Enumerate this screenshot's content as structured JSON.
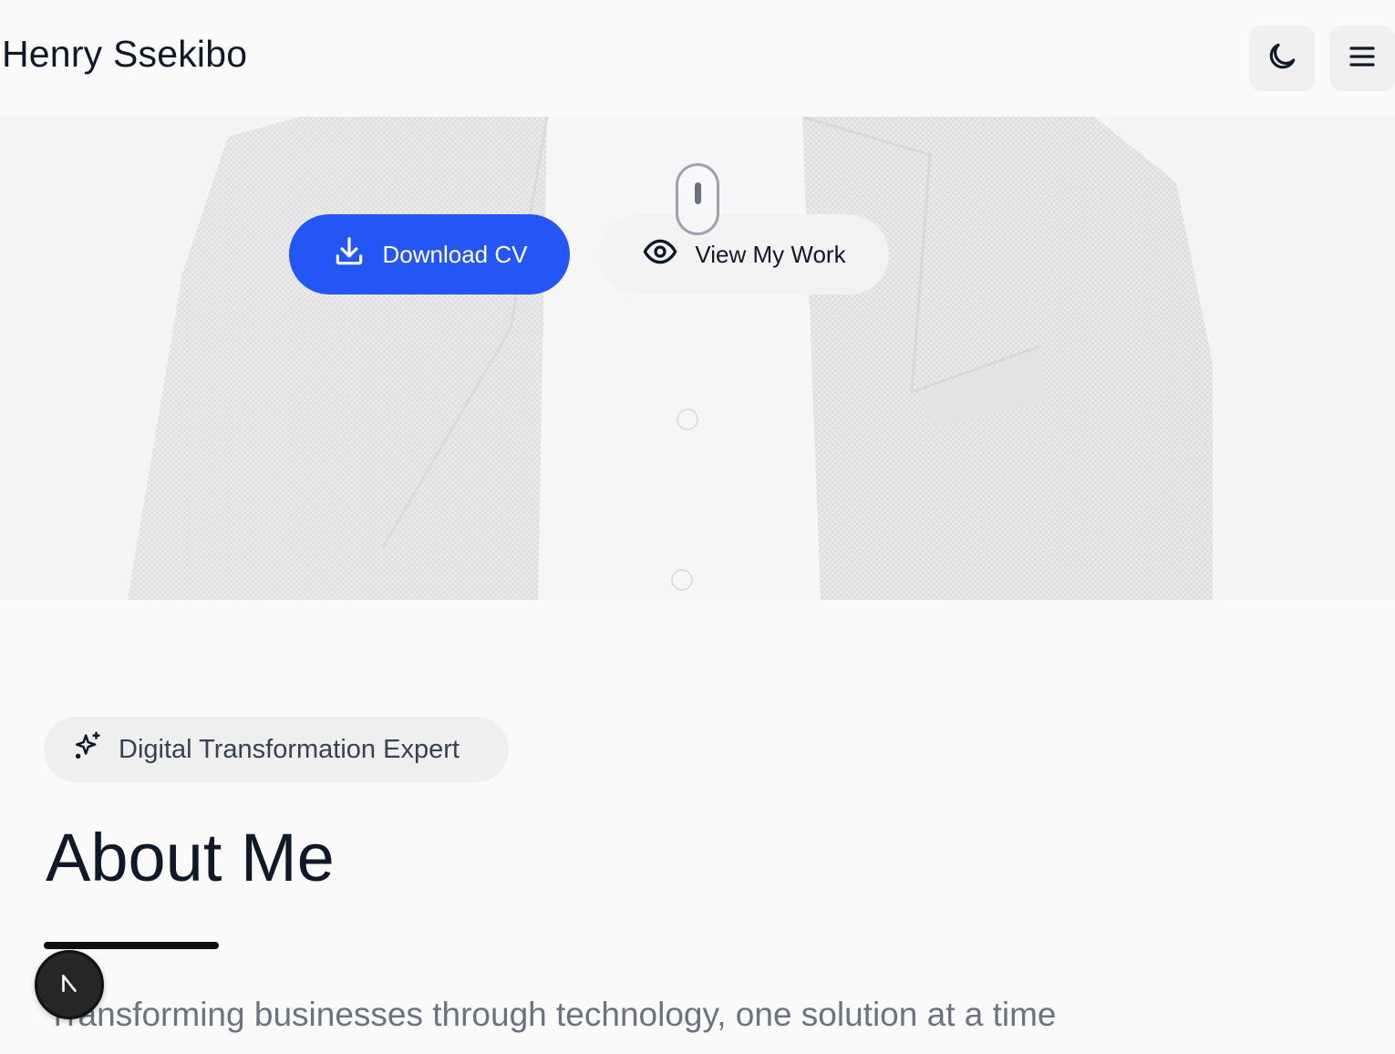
{
  "header": {
    "brand": "Henry Ssekibo",
    "theme_toggle_icon": "moon-icon",
    "menu_icon": "hamburger-menu-icon"
  },
  "hero": {
    "primary_button": {
      "label": "Download CV",
      "icon": "download-icon"
    },
    "secondary_button": {
      "label": "View My Work",
      "icon": "eye-icon"
    },
    "scroll_indicator_icon": "mouse-scroll-icon"
  },
  "about": {
    "badge": {
      "label": "Digital Transformation Expert",
      "icon": "sparkles-icon"
    },
    "title": "About Me",
    "tagline": "Transforming businesses through technology, one solution at a time"
  },
  "floating_button": {
    "icon": "arrow-up-left-icon"
  },
  "colors": {
    "accent": "#2456f5",
    "text": "#111827",
    "muted": "#6b7280",
    "surface": "#efeff0"
  }
}
